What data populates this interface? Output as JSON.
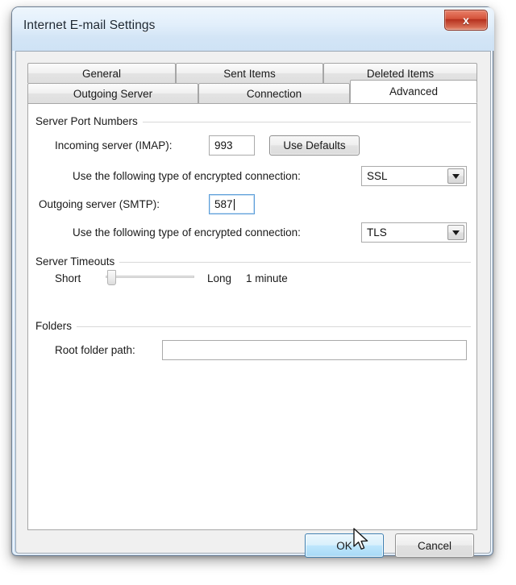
{
  "window": {
    "title": "Internet E-mail Settings",
    "close_glyph": "x",
    "close_icon_name": "close-icon"
  },
  "tabs": {
    "row1": [
      {
        "label": "General",
        "selected": false
      },
      {
        "label": "Sent Items",
        "selected": false
      },
      {
        "label": "Deleted Items",
        "selected": false
      }
    ],
    "row2": [
      {
        "label": "Outgoing Server",
        "selected": false
      },
      {
        "label": "Connection",
        "selected": false
      },
      {
        "label": "Advanced",
        "selected": true
      }
    ]
  },
  "groups": {
    "server_port_numbers": {
      "legend": "Server Port Numbers",
      "incoming_label": "Incoming server (IMAP):",
      "incoming_value": "993",
      "use_defaults_label": "Use Defaults",
      "incoming_encryption_label": "Use the following type of encrypted connection:",
      "incoming_encryption_value": "SSL",
      "outgoing_label": "Outgoing server (SMTP):",
      "outgoing_value": "587",
      "outgoing_encryption_label": "Use the following type of encrypted connection:",
      "outgoing_encryption_value": "TLS"
    },
    "server_timeouts": {
      "legend": "Server Timeouts",
      "short_label": "Short",
      "long_label": "Long",
      "value_label": "1 minute"
    },
    "folders": {
      "legend": "Folders",
      "root_folder_label": "Root folder path:",
      "root_folder_value": ""
    }
  },
  "footer": {
    "ok_label": "OK",
    "cancel_label": "Cancel"
  },
  "colors": {
    "accent": "#3c7fb1",
    "close_red": "#b5301d",
    "focus_blue": "#5b9dd9",
    "panel": "#ffffff",
    "dialog_face": "#f0f0f0"
  }
}
